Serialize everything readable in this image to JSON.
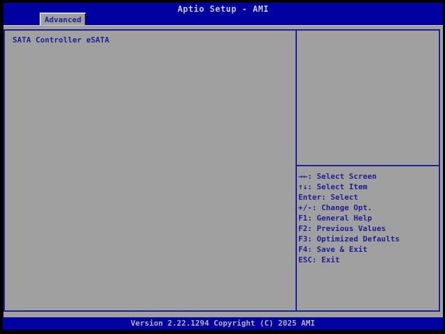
{
  "header": {
    "title": "Aptio Setup - AMI",
    "tabs": [
      {
        "label": "Advanced",
        "active": true
      }
    ]
  },
  "main": {
    "left_panel": {
      "items": [
        {
          "label": "SATA Controller eSATA",
          "selected": false
        }
      ]
    }
  },
  "help_panel": {
    "lines": [
      "→←: Select Screen",
      "↑↓: Select Item",
      "Enter: Select",
      "+/-: Change Opt.",
      "F1: General Help",
      "F2: Previous Values",
      "F3: Optimized Defaults",
      "F4: Save & Exit",
      "ESC: Exit"
    ]
  },
  "footer": {
    "version_text": "Version 2.22.1294 Copyright (C) 2025 AMI"
  },
  "colors": {
    "header_bg": "#0000a0",
    "body_bg": "#a0a0a0",
    "accent_navy": "#1e1e96",
    "header_text": "#c8c8c8",
    "footer_text": "#b4b4b4"
  }
}
